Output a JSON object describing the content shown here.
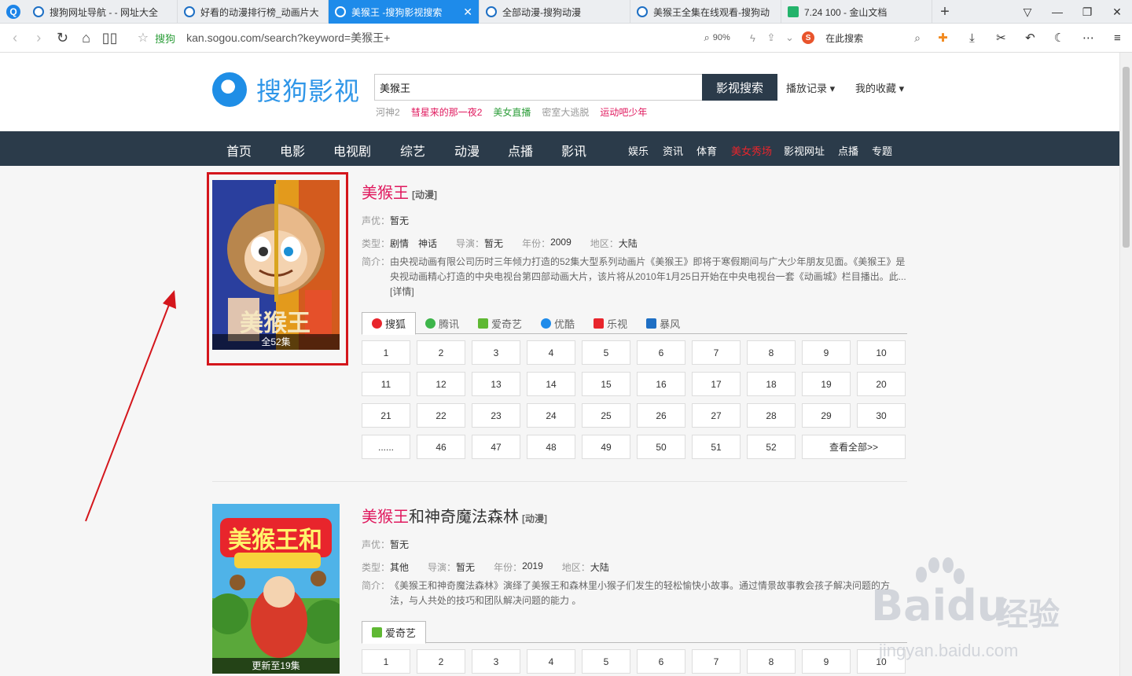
{
  "browser": {
    "tabs": [
      {
        "label": "搜狗网址导航 - - 网址大全",
        "active": false
      },
      {
        "label": "好看的动漫排行榜_动画片大",
        "active": false
      },
      {
        "label": "美猴王 -搜狗影视搜索",
        "active": true
      },
      {
        "label": "全部动漫-搜狗动漫",
        "active": false
      },
      {
        "label": "美猴王全集在线观看-搜狗动",
        "active": false
      },
      {
        "label": "7.24 100 - 金山文档",
        "active": false
      }
    ],
    "address_site": "搜狗",
    "address_url": "kan.sogou.com/search?keyword=美猴王+",
    "zoom": "90%",
    "search_placeholder": "在此搜索",
    "accent_color": "#1e8bea"
  },
  "header": {
    "brand": "搜狗影视",
    "search_value": "美猴王",
    "search_button": "影视搜索",
    "history": "播放记录",
    "favorites": "我的收藏",
    "hot_keywords": [
      {
        "text": "河神2",
        "color": "#999999"
      },
      {
        "text": "彗星来的那一夜2",
        "color": "#e0195e"
      },
      {
        "text": "美女直播",
        "color": "#2e9e3b"
      },
      {
        "text": "密室大逃脱",
        "color": "#999999"
      },
      {
        "text": "运动吧少年",
        "color": "#e0195e"
      }
    ]
  },
  "nav": {
    "main": [
      "首页",
      "电影",
      "电视剧",
      "综艺",
      "动漫",
      "点播",
      "影讯"
    ],
    "secondary": [
      "娱乐",
      "资讯",
      "体育",
      "美女秀场",
      "影视网址",
      "点播",
      "专题"
    ]
  },
  "results": [
    {
      "title_highlight": "美猴王",
      "title_rest": "",
      "type_tag": "[动漫]",
      "poster_caption": "全52集",
      "voice_label": "声优：",
      "voice": "暂无",
      "genre_label": "类型：",
      "genres": "剧情　神话",
      "director_label": "导演：",
      "director": "暂无",
      "year_label": "年份：",
      "year": "2009",
      "region_label": "地区：",
      "region": "大陆",
      "desc_label": "简介：",
      "description": "由央视动画有限公司历时三年倾力打造的52集大型系列动画片《美猴王》即将于寒假期间与广大少年朋友见面。《美猴王》是央视动画精心打造的中央电视台第四部动画大片，该片将从2010年1月25日开始在中央电视台一套《动画城》栏目播出。此...",
      "detail_link": "[详情]",
      "sources": [
        {
          "name": "搜狐",
          "color": "#e8252c"
        },
        {
          "name": "腾讯",
          "color": "#3db54a"
        },
        {
          "name": "爱奇艺",
          "color": "#5fb833"
        },
        {
          "name": "优酷",
          "color": "#1e8bea"
        },
        {
          "name": "乐视",
          "color": "#e8252c"
        },
        {
          "name": "暴风",
          "color": "#1e6fc4"
        }
      ],
      "episodes": [
        "1",
        "2",
        "3",
        "4",
        "5",
        "6",
        "7",
        "8",
        "9",
        "10",
        "11",
        "12",
        "13",
        "14",
        "15",
        "16",
        "17",
        "18",
        "19",
        "20",
        "21",
        "22",
        "23",
        "24",
        "25",
        "26",
        "27",
        "28",
        "29",
        "30",
        "......",
        "46",
        "47",
        "48",
        "49",
        "50",
        "51",
        "52"
      ],
      "view_all": "查看全部>>"
    },
    {
      "title_highlight": "美猴王",
      "title_rest": "和神奇魔法森林",
      "type_tag": "[动漫]",
      "poster_caption": "更新至19集",
      "voice_label": "声优：",
      "voice": "暂无",
      "genre_label": "类型：",
      "genres": "其他",
      "director_label": "导演：",
      "director": "暂无",
      "year_label": "年份：",
      "year": "2019",
      "region_label": "地区：",
      "region": "大陆",
      "desc_label": "简介：",
      "description": "《美猴王和神奇魔法森林》演绎了美猴王和森林里小猴子们发生的轻松愉快小故事。通过情景故事教会孩子解决问题的方法，与人共处的技巧和团队解决问题的能力 。",
      "sources": [
        {
          "name": "爱奇艺",
          "color": "#5fb833"
        }
      ],
      "episodes": [
        "1",
        "2",
        "3",
        "4",
        "5",
        "6",
        "7",
        "8",
        "9",
        "10"
      ]
    }
  ],
  "watermark": {
    "brand": "Bai",
    "brand2": "du",
    "product": "经验",
    "url": "jingyan.baidu.com"
  }
}
